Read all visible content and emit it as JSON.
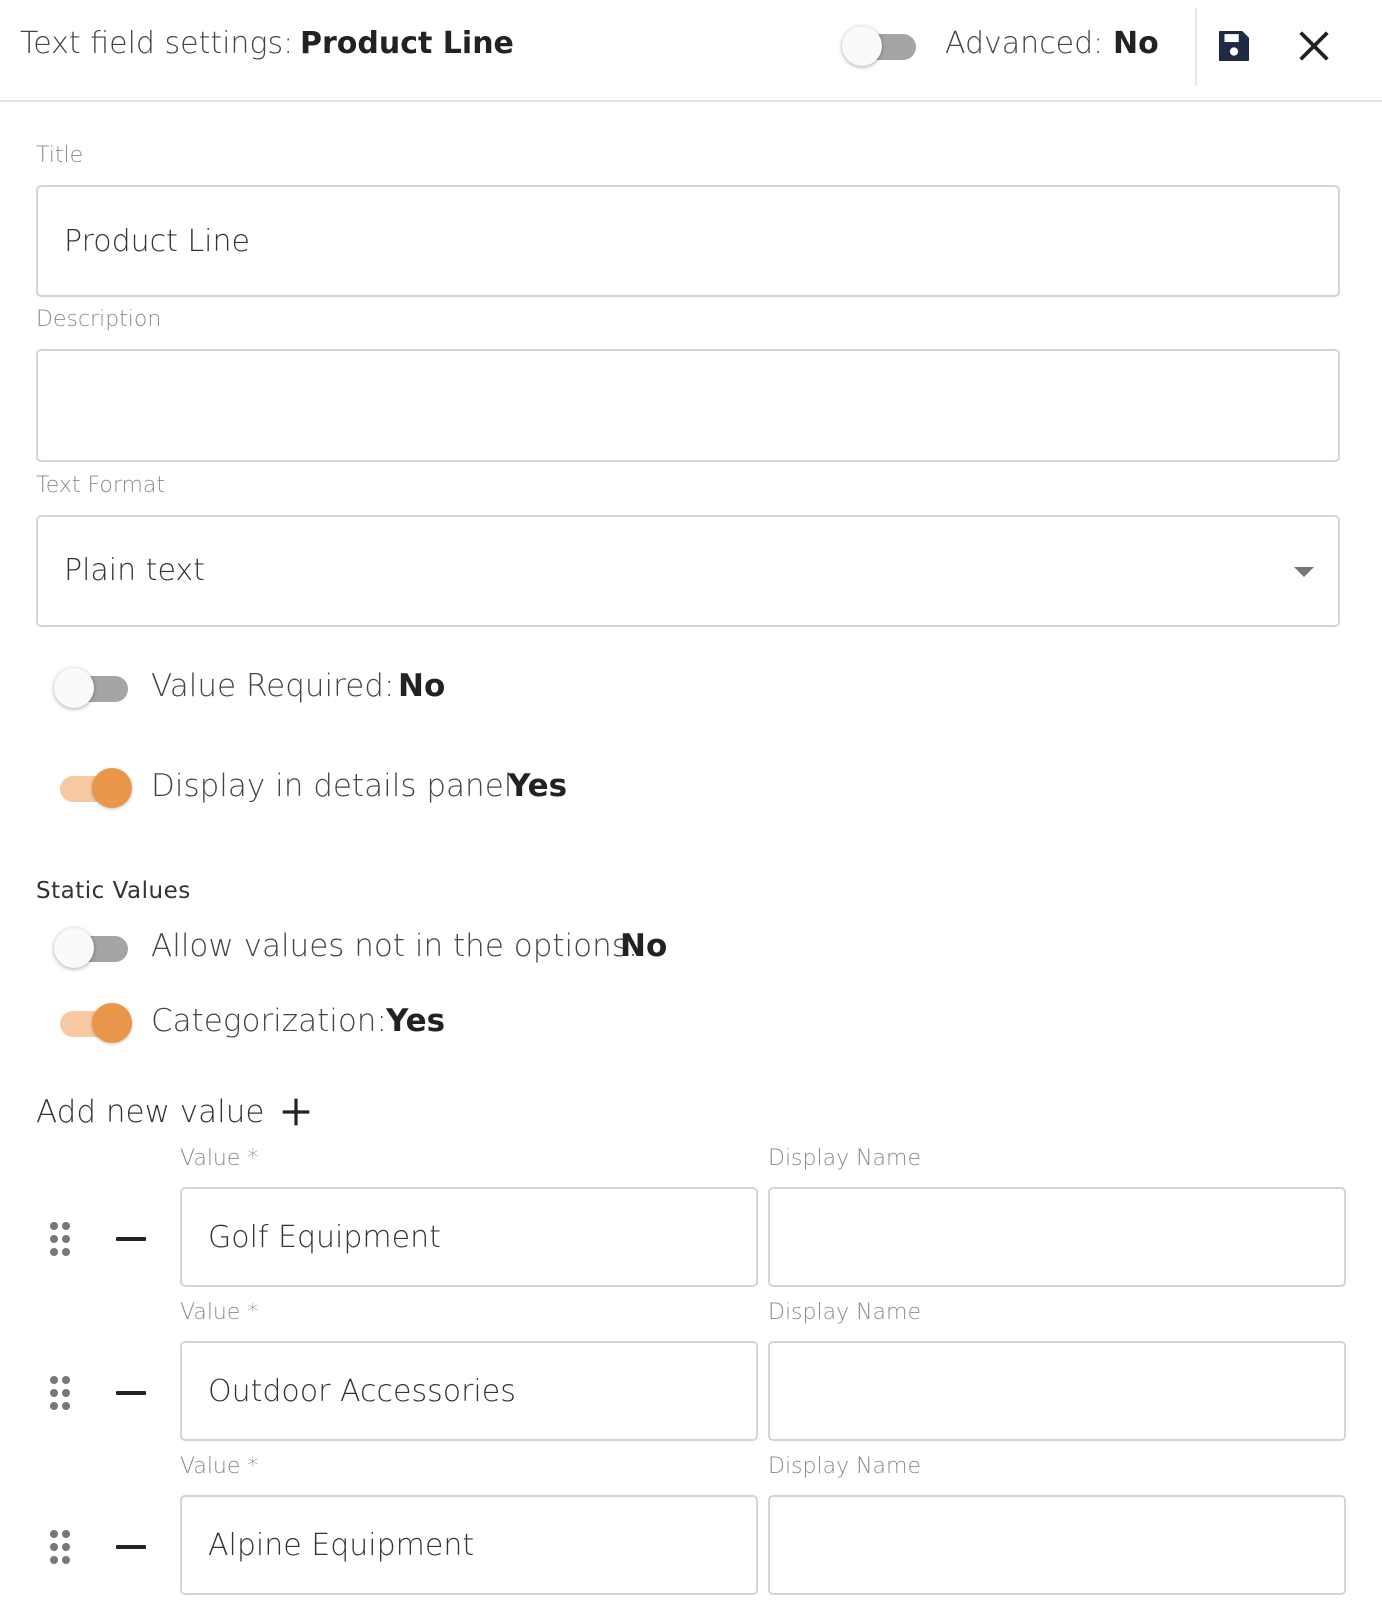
{
  "header": {
    "title": "Text field settings:",
    "field_name": "Product Line",
    "advanced_label": "Advanced:",
    "advanced_value": "No",
    "advanced_on": false,
    "save_icon": "save-icon",
    "close_icon": "close-icon"
  },
  "form": {
    "title_label": "Title",
    "title_value": "Product Line",
    "description_label": "Description",
    "description_value": "",
    "text_format_label": "Text Format",
    "text_format_value": "Plain text"
  },
  "switches": {
    "value_required": {
      "label": "Value Required:",
      "value": "No",
      "on": false
    },
    "display_details": {
      "label": "Display in details panel:",
      "value": "Yes",
      "on": true
    }
  },
  "static_values": {
    "section_title": "Static Values",
    "allow_values": {
      "label": "Allow values not in the options:",
      "value": "No",
      "on": false
    },
    "categorization": {
      "label": "Categorization:",
      "value": "Yes",
      "on": true
    },
    "add_label": "Add new value",
    "value_col_label": "Value *",
    "display_col_label": "Display Name",
    "rows": [
      {
        "value": "Golf Equipment",
        "display_name": ""
      },
      {
        "value": "Outdoor Accessories",
        "display_name": ""
      },
      {
        "value": "Alpine Equipment",
        "display_name": ""
      }
    ]
  },
  "colors": {
    "accent": "#e8964a",
    "accent_track": "#f6c9a2",
    "save_icon": "#1f2a44"
  }
}
